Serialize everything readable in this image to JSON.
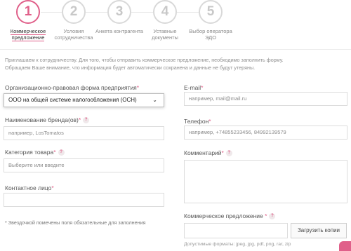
{
  "steps": [
    {
      "num": "1",
      "label": "Коммерческое предложение"
    },
    {
      "num": "2",
      "label": "Условия сотрудничества"
    },
    {
      "num": "3",
      "label": "Анкета контрагента"
    },
    {
      "num": "4",
      "label": "Уставные документы"
    },
    {
      "num": "5",
      "label": "Выбор оператора ЭДО"
    }
  ],
  "intro": {
    "line1": "Приглашаем к сотрудничеству. Для того, чтобы отправить коммерческое предложение, необходимо заполнить форму.",
    "line2": "Обращаем Ваше внимание, что информация будет автоматически сохранена и данные не будут утеряны."
  },
  "form": {
    "org_form": {
      "label": "Организационно-правовая форма предприятия",
      "required": "*",
      "value": "ООО на общей системе налогообложения (ОСН)"
    },
    "brand": {
      "label": "Наименование бренда(ов)",
      "required": "*",
      "help": "?",
      "placeholder": "например, LosTomatos"
    },
    "category": {
      "label": "Категория товара",
      "required": "*",
      "help": "?",
      "placeholder": "Выберите или введите"
    },
    "contact": {
      "label": "Контактное лицо",
      "required": "*",
      "value": ""
    },
    "email": {
      "label": "E-mail",
      "required": "*",
      "placeholder": "например, mail@mail.ru"
    },
    "phone": {
      "label": "Телефон",
      "required": "*",
      "placeholder": "например, +74855233456, 84992139579"
    },
    "comment": {
      "label": "Комментарий",
      "required": "*",
      "help": "?"
    },
    "offer": {
      "label": "Коммерческое предложение",
      "required": "*",
      "help": "?",
      "button": "Загрузить копии",
      "formats": "Допустимые форматы: jpeg, jpg, pdf, png, rar, zip"
    }
  },
  "note": "* Звездочкой помечены поля обязательные для заполнения",
  "colors": {
    "accent": "#e0608a",
    "inactive": "#d9d9d9"
  }
}
